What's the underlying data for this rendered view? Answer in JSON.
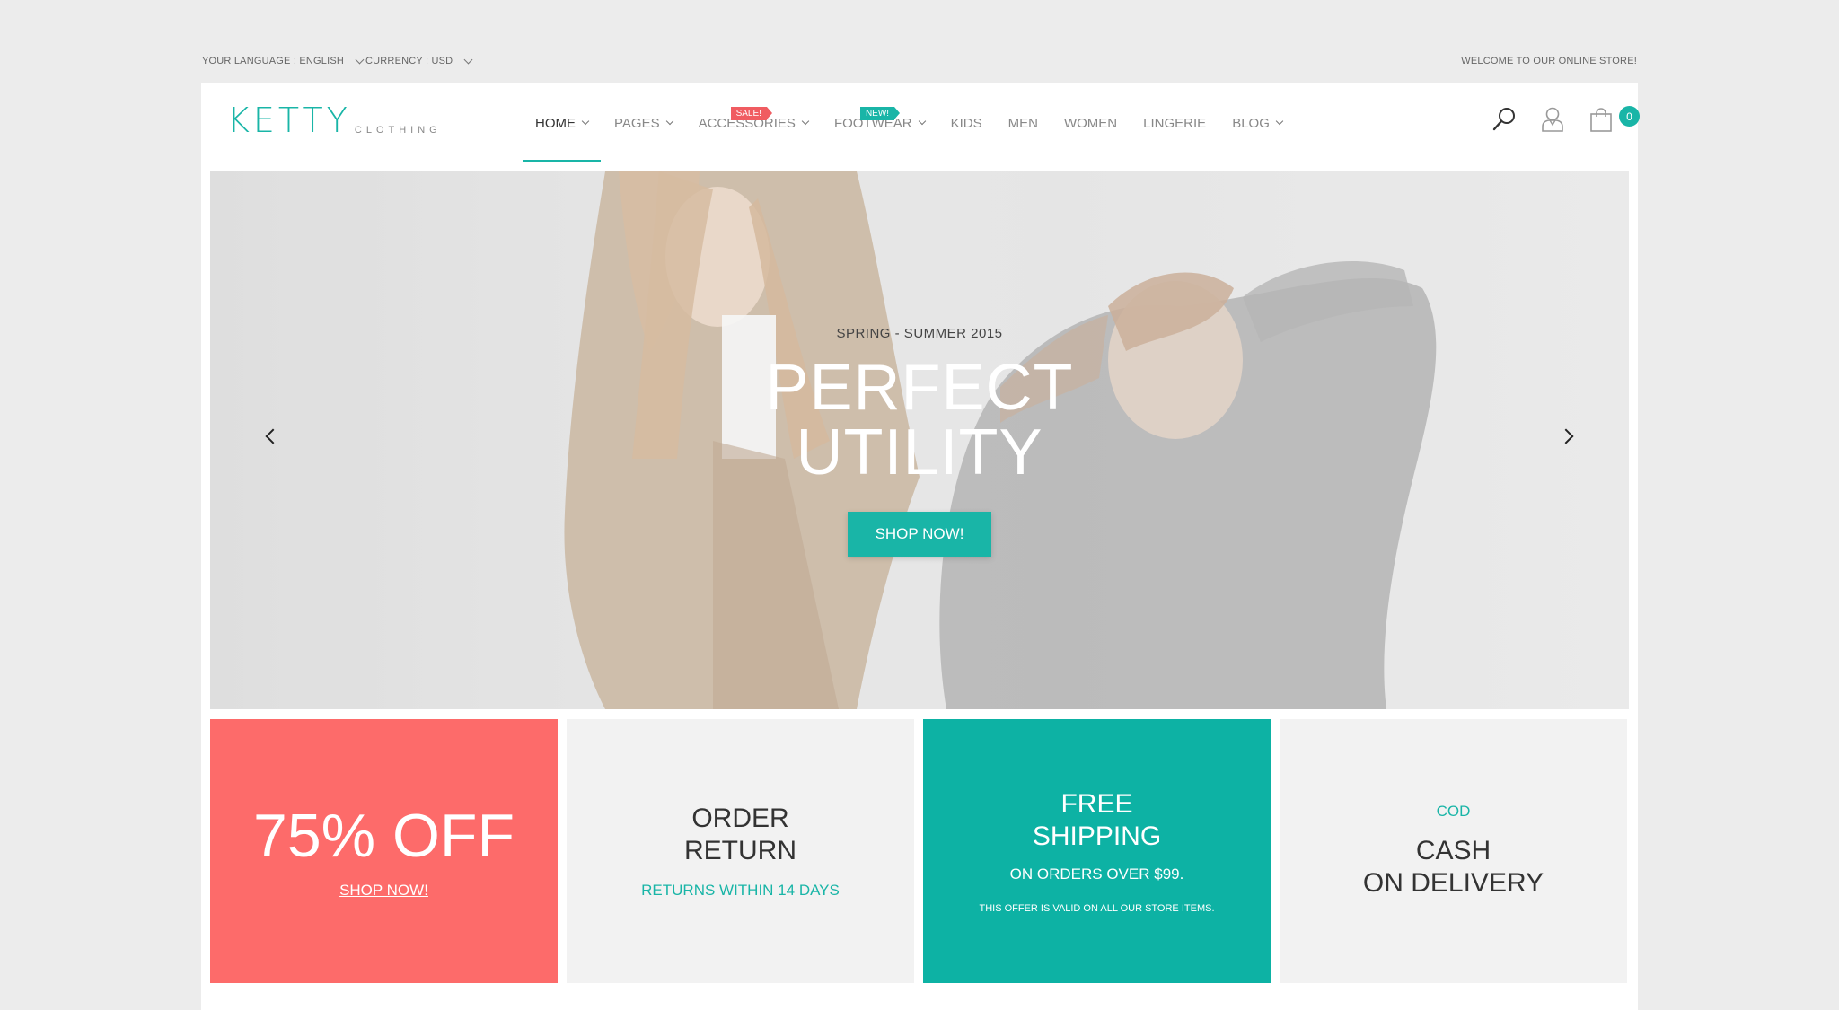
{
  "topbar": {
    "language": "YOUR LANGUAGE : ENGLISH",
    "currency": "CURRENCY : USD",
    "welcome": "WELCOME TO OUR ONLINE STORE!"
  },
  "logo": {
    "main": "KETTY",
    "sub": "CLOTHING"
  },
  "nav": {
    "items": [
      {
        "label": "HOME",
        "dropdown": true,
        "active": true
      },
      {
        "label": "PAGES",
        "dropdown": true
      },
      {
        "label": "ACCESSORIES",
        "dropdown": true,
        "badge": "SALE!"
      },
      {
        "label": "FOOTWEAR",
        "dropdown": true,
        "badge": "NEW!"
      },
      {
        "label": "KIDS"
      },
      {
        "label": "MEN"
      },
      {
        "label": "WOMEN"
      },
      {
        "label": "LINGERIE"
      },
      {
        "label": "BLOG",
        "dropdown": true
      }
    ]
  },
  "header_icons": {
    "search": "search-icon",
    "account": "user-icon",
    "cart": "shopping-bag-icon",
    "cart_count": "0"
  },
  "hero": {
    "subtitle": "SPRING - SUMMER 2015",
    "title_line1": "PERFECT",
    "title_line2": "UTILITY",
    "button": "SHOP NOW!"
  },
  "tiles": {
    "t1": {
      "big": "75% OFF",
      "link": "SHOP NOW!"
    },
    "t2": {
      "line1": "ORDER",
      "line2": "RETURN",
      "sub": "RETURNS WITHIN 14 DAYS"
    },
    "t3": {
      "line1": "FREE",
      "line2": "SHIPPING",
      "sub": "ON ORDERS OVER $99.",
      "fine": "THIS OFFER IS VALID ON ALL OUR STORE ITEMS."
    },
    "t4": {
      "top": "COD",
      "line1": "CASH",
      "line2": "ON DELIVERY"
    }
  },
  "colors": {
    "accent": "#19b5a7",
    "coral": "#fd6b6a",
    "sale_badge": "#f05c61",
    "page_bg": "#ececec"
  }
}
